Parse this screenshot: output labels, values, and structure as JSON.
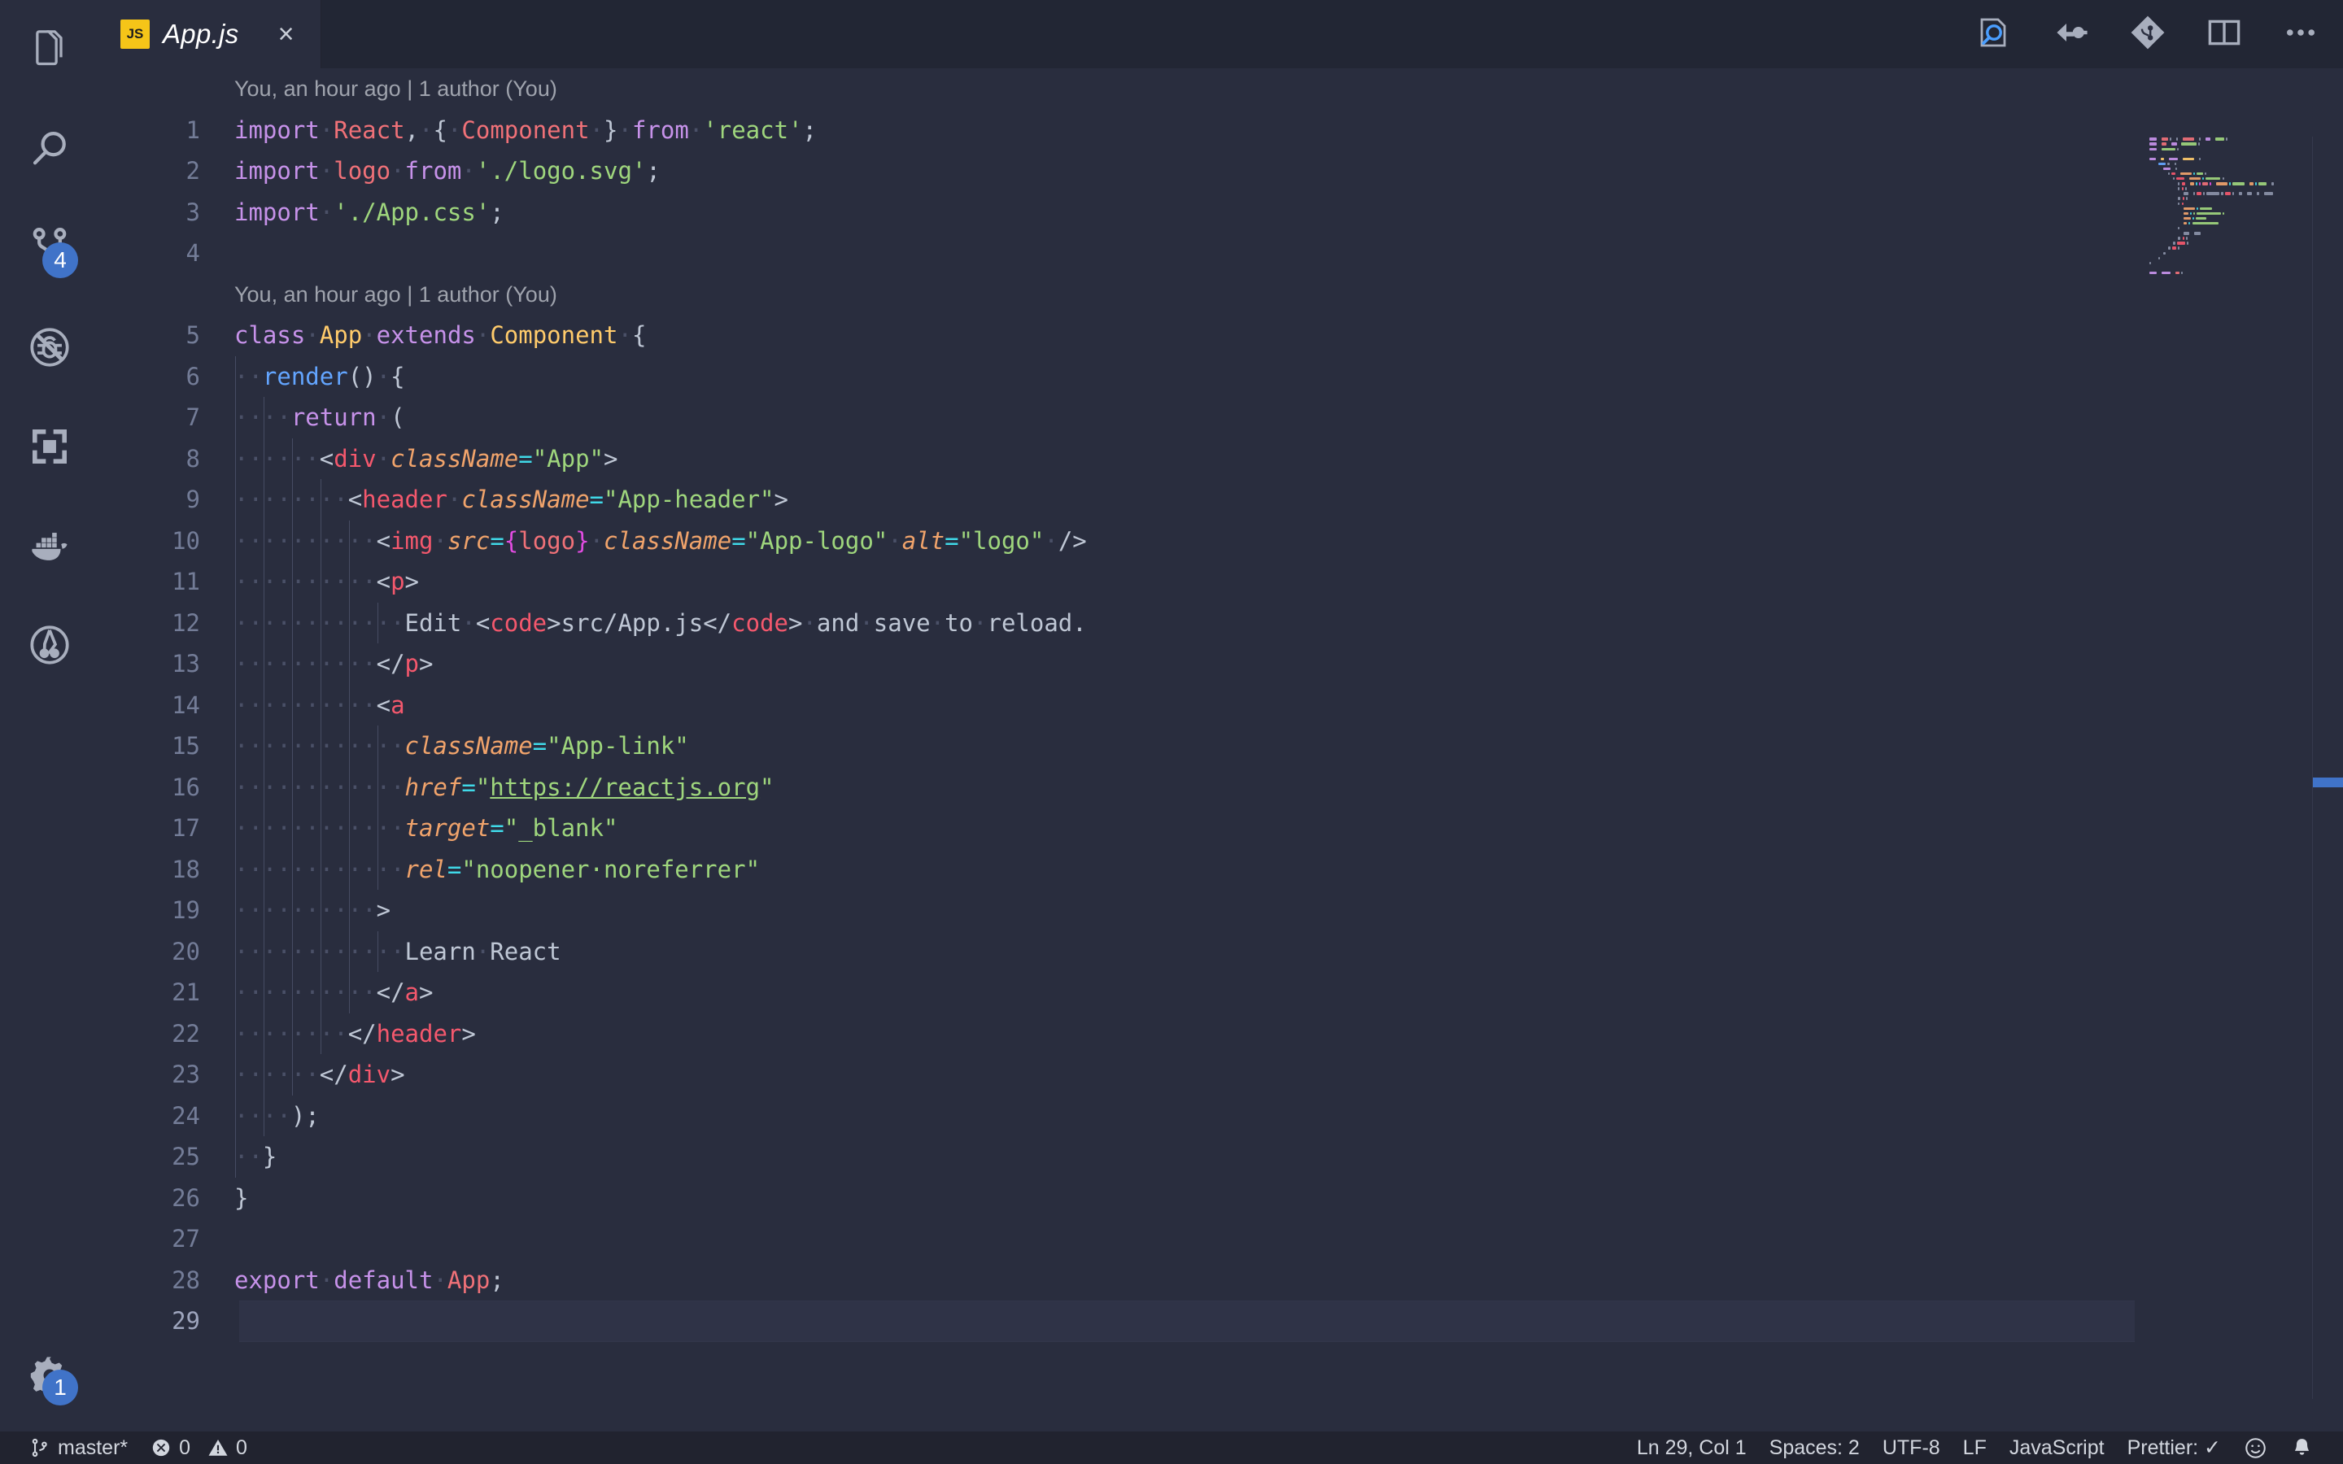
{
  "theme": {
    "bg": "#292d3e",
    "statusbar_bg": "#21232f",
    "badge_bg": "#4073c8",
    "accent_js": "#f5c518",
    "keyword": "#c792ea",
    "variable": "#f07178",
    "string": "#9fd67d",
    "class": "#ffcb6b",
    "function": "#63a5ff",
    "tag": "#f4586d",
    "attribute": "#f0a36b",
    "operator": "#40d9e8",
    "brace": "#e14ce1",
    "text": "#bfc7d5",
    "linenumber": "#737c97",
    "blame": "#9fa3ad"
  },
  "activitybar": {
    "items": [
      {
        "icon": "explorer-files-icon",
        "name": "sidebar-item-explorer",
        "badge": null
      },
      {
        "icon": "search-icon",
        "name": "sidebar-item-search",
        "badge": null
      },
      {
        "icon": "source-control-branch-icon",
        "name": "sidebar-item-source-control",
        "badge": "4"
      },
      {
        "icon": "run-and-debug-disabled-icon",
        "name": "sidebar-item-run-debug",
        "badge": null
      },
      {
        "icon": "extensions-icon",
        "name": "sidebar-item-extensions",
        "badge": null
      },
      {
        "icon": "docker-whale-icon",
        "name": "sidebar-item-docker",
        "badge": null
      },
      {
        "icon": "gitlens-icon",
        "name": "sidebar-item-gitlens",
        "badge": null
      }
    ],
    "bottom": [
      {
        "icon": "gear-icon",
        "name": "manage-settings-button",
        "badge": "1"
      }
    ]
  },
  "tabs": [
    {
      "label": "App.js",
      "badge": "JS",
      "active": true,
      "preview": true,
      "close": "×"
    }
  ],
  "editor_actions": [
    {
      "icon": "search-in-file-icon",
      "name": "find-in-file-button"
    },
    {
      "icon": "open-preview-icon",
      "name": "open-preview-button"
    },
    {
      "icon": "git-compare-icon",
      "name": "git-compare-button"
    },
    {
      "icon": "split-editor-icon",
      "name": "split-editor-button"
    },
    {
      "icon": "more-actions-icon",
      "name": "more-actions-button"
    }
  ],
  "editor": {
    "filename": "App.js",
    "language": "JavaScript",
    "blame_annotations": [
      {
        "after_line": 0,
        "text": "You, an hour ago | 1 author (You)"
      },
      {
        "after_line": 4,
        "text": "You, an hour ago | 1 author (You)"
      }
    ],
    "current_line": 29,
    "lines": [
      {
        "n": 1,
        "indent": 0,
        "tokens": [
          [
            "kw",
            "import"
          ],
          [
            "ws",
            "·"
          ],
          [
            "var",
            "React"
          ],
          [
            "punc",
            ","
          ],
          [
            "ws",
            "·"
          ],
          [
            "punc",
            "{"
          ],
          [
            "ws",
            "·"
          ],
          [
            "var",
            "Component"
          ],
          [
            "ws",
            "·"
          ],
          [
            "punc",
            "}"
          ],
          [
            "ws",
            "·"
          ],
          [
            "kw",
            "from"
          ],
          [
            "ws",
            "·"
          ],
          [
            "str",
            "'react'"
          ],
          [
            "punc",
            ";"
          ]
        ]
      },
      {
        "n": 2,
        "indent": 0,
        "tokens": [
          [
            "kw",
            "import"
          ],
          [
            "ws",
            "·"
          ],
          [
            "var",
            "logo"
          ],
          [
            "ws",
            "·"
          ],
          [
            "kw",
            "from"
          ],
          [
            "ws",
            "·"
          ],
          [
            "str",
            "'./logo.svg'"
          ],
          [
            "punc",
            ";"
          ]
        ]
      },
      {
        "n": 3,
        "indent": 0,
        "tokens": [
          [
            "kw",
            "import"
          ],
          [
            "ws",
            "·"
          ],
          [
            "str",
            "'./App.css'"
          ],
          [
            "punc",
            ";"
          ]
        ]
      },
      {
        "n": 4,
        "indent": 0,
        "tokens": []
      },
      {
        "n": 5,
        "indent": 0,
        "tokens": [
          [
            "kw",
            "class"
          ],
          [
            "ws",
            "·"
          ],
          [
            "cls",
            "App"
          ],
          [
            "ws",
            "·"
          ],
          [
            "kw",
            "extends"
          ],
          [
            "ws",
            "·"
          ],
          [
            "cls",
            "Component"
          ],
          [
            "ws",
            "·"
          ],
          [
            "punc",
            "{"
          ]
        ]
      },
      {
        "n": 6,
        "indent": 1,
        "tokens": [
          [
            "ws",
            "··"
          ],
          [
            "fn",
            "render"
          ],
          [
            "punc",
            "()"
          ],
          [
            "ws",
            "·"
          ],
          [
            "punc",
            "{"
          ]
        ]
      },
      {
        "n": 7,
        "indent": 2,
        "tokens": [
          [
            "ws",
            "····"
          ],
          [
            "kw",
            "return"
          ],
          [
            "ws",
            "·"
          ],
          [
            "punc",
            "("
          ]
        ]
      },
      {
        "n": 8,
        "indent": 3,
        "tokens": [
          [
            "ws",
            "······"
          ],
          [
            "punc",
            "<"
          ],
          [
            "tag",
            "div"
          ],
          [
            "ws",
            "·"
          ],
          [
            "attr",
            "className"
          ],
          [
            "op",
            "="
          ],
          [
            "str",
            "\"App\""
          ],
          [
            "punc",
            ">"
          ]
        ]
      },
      {
        "n": 9,
        "indent": 4,
        "tokens": [
          [
            "ws",
            "········"
          ],
          [
            "punc",
            "<"
          ],
          [
            "tag",
            "header"
          ],
          [
            "ws",
            "·"
          ],
          [
            "attr",
            "className"
          ],
          [
            "op",
            "="
          ],
          [
            "str",
            "\"App-header\""
          ],
          [
            "punc",
            ">"
          ]
        ]
      },
      {
        "n": 10,
        "indent": 5,
        "tokens": [
          [
            "ws",
            "··········"
          ],
          [
            "punc",
            "<"
          ],
          [
            "tag",
            "img"
          ],
          [
            "ws",
            "·"
          ],
          [
            "attr",
            "src"
          ],
          [
            "op",
            "="
          ],
          [
            "brace",
            "{"
          ],
          [
            "var",
            "logo"
          ],
          [
            "brace",
            "}"
          ],
          [
            "ws",
            "·"
          ],
          [
            "attr",
            "className"
          ],
          [
            "op",
            "="
          ],
          [
            "str",
            "\"App-logo\""
          ],
          [
            "ws",
            "·"
          ],
          [
            "attr",
            "alt"
          ],
          [
            "op",
            "="
          ],
          [
            "str",
            "\"logo\""
          ],
          [
            "ws",
            "·"
          ],
          [
            "punc",
            "/>"
          ]
        ]
      },
      {
        "n": 11,
        "indent": 5,
        "tokens": [
          [
            "ws",
            "··········"
          ],
          [
            "punc",
            "<"
          ],
          [
            "tag",
            "p"
          ],
          [
            "punc",
            ">"
          ]
        ]
      },
      {
        "n": 12,
        "indent": 6,
        "tokens": [
          [
            "ws",
            "············"
          ],
          [
            "txt",
            "Edit"
          ],
          [
            "ws",
            "·"
          ],
          [
            "punc",
            "<"
          ],
          [
            "tag",
            "code"
          ],
          [
            "punc",
            ">"
          ],
          [
            "txt",
            "src/App.js"
          ],
          [
            "punc",
            "</"
          ],
          [
            "tag",
            "code"
          ],
          [
            "punc",
            ">"
          ],
          [
            "ws",
            "·"
          ],
          [
            "txt",
            "and"
          ],
          [
            "ws",
            "·"
          ],
          [
            "txt",
            "save"
          ],
          [
            "ws",
            "·"
          ],
          [
            "txt",
            "to"
          ],
          [
            "ws",
            "·"
          ],
          [
            "txt",
            "reload."
          ]
        ]
      },
      {
        "n": 13,
        "indent": 5,
        "tokens": [
          [
            "ws",
            "··········"
          ],
          [
            "punc",
            "</"
          ],
          [
            "tag",
            "p"
          ],
          [
            "punc",
            ">"
          ]
        ]
      },
      {
        "n": 14,
        "indent": 5,
        "tokens": [
          [
            "ws",
            "··········"
          ],
          [
            "punc",
            "<"
          ],
          [
            "tag",
            "a"
          ]
        ]
      },
      {
        "n": 15,
        "indent": 6,
        "tokens": [
          [
            "ws",
            "············"
          ],
          [
            "attr",
            "className"
          ],
          [
            "op",
            "="
          ],
          [
            "str",
            "\"App-link\""
          ]
        ]
      },
      {
        "n": 16,
        "indent": 6,
        "tokens": [
          [
            "ws",
            "············"
          ],
          [
            "attr",
            "href"
          ],
          [
            "op",
            "="
          ],
          [
            "str",
            "\""
          ],
          [
            "link",
            "https://reactjs.org"
          ],
          [
            "str",
            "\""
          ]
        ]
      },
      {
        "n": 17,
        "indent": 6,
        "tokens": [
          [
            "ws",
            "············"
          ],
          [
            "attr",
            "target"
          ],
          [
            "op",
            "="
          ],
          [
            "str",
            "\"_blank\""
          ]
        ]
      },
      {
        "n": 18,
        "indent": 6,
        "tokens": [
          [
            "ws",
            "············"
          ],
          [
            "attr",
            "rel"
          ],
          [
            "op",
            "="
          ],
          [
            "str",
            "\"noopener·noreferrer\""
          ]
        ]
      },
      {
        "n": 19,
        "indent": 5,
        "tokens": [
          [
            "ws",
            "··········"
          ],
          [
            "punc",
            ">"
          ]
        ]
      },
      {
        "n": 20,
        "indent": 6,
        "tokens": [
          [
            "ws",
            "············"
          ],
          [
            "txt",
            "Learn"
          ],
          [
            "ws",
            "·"
          ],
          [
            "txt",
            "React"
          ]
        ]
      },
      {
        "n": 21,
        "indent": 5,
        "tokens": [
          [
            "ws",
            "··········"
          ],
          [
            "punc",
            "</"
          ],
          [
            "tag",
            "a"
          ],
          [
            "punc",
            ">"
          ]
        ]
      },
      {
        "n": 22,
        "indent": 4,
        "tokens": [
          [
            "ws",
            "········"
          ],
          [
            "punc",
            "</"
          ],
          [
            "tag",
            "header"
          ],
          [
            "punc",
            ">"
          ]
        ]
      },
      {
        "n": 23,
        "indent": 3,
        "tokens": [
          [
            "ws",
            "······"
          ],
          [
            "punc",
            "</"
          ],
          [
            "tag",
            "div"
          ],
          [
            "punc",
            ">"
          ]
        ]
      },
      {
        "n": 24,
        "indent": 2,
        "tokens": [
          [
            "ws",
            "····"
          ],
          [
            "punc",
            ");"
          ]
        ]
      },
      {
        "n": 25,
        "indent": 1,
        "tokens": [
          [
            "ws",
            "··"
          ],
          [
            "punc",
            "}"
          ]
        ]
      },
      {
        "n": 26,
        "indent": 0,
        "tokens": [
          [
            "punc",
            "}"
          ]
        ]
      },
      {
        "n": 27,
        "indent": 0,
        "tokens": []
      },
      {
        "n": 28,
        "indent": 0,
        "tokens": [
          [
            "kw",
            "export"
          ],
          [
            "ws",
            "·"
          ],
          [
            "kw",
            "default"
          ],
          [
            "ws",
            "·"
          ],
          [
            "var",
            "App"
          ],
          [
            "punc",
            ";"
          ]
        ]
      },
      {
        "n": 29,
        "indent": 0,
        "tokens": []
      }
    ]
  },
  "statusbar": {
    "left": [
      {
        "name": "status-branch",
        "icon": "git-branch-icon",
        "label": "master*"
      },
      {
        "name": "status-problems",
        "icon": "error-warning-icons",
        "label": "0",
        "label2": "0"
      }
    ],
    "right": [
      {
        "name": "status-cursor-position",
        "label": "Ln 29, Col 1"
      },
      {
        "name": "status-indentation",
        "label": "Spaces: 2"
      },
      {
        "name": "status-encoding",
        "label": "UTF-8"
      },
      {
        "name": "status-eol",
        "label": "LF"
      },
      {
        "name": "status-language-mode",
        "label": "JavaScript"
      },
      {
        "name": "status-prettier",
        "label": "Prettier: ✓"
      },
      {
        "name": "status-feedback-smiley",
        "icon": "smiley-icon",
        "label": ""
      },
      {
        "name": "status-notifications-bell",
        "icon": "bell-icon",
        "label": ""
      }
    ]
  }
}
